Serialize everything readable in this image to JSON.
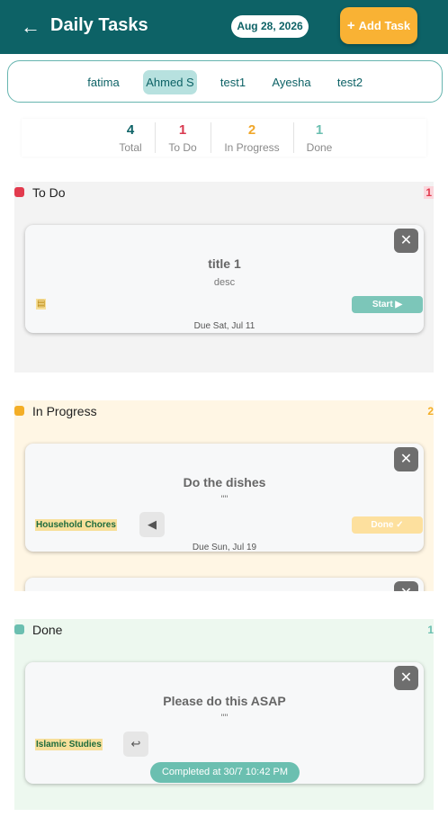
{
  "header": {
    "title": "Daily Tasks",
    "back_icon": "arrow-left-icon",
    "back_glyph": "←",
    "date": "Aug 28, 2026",
    "add_task_icon": "plus-icon",
    "add_task_glyph": "+",
    "add_task_label": "Add Task"
  },
  "users": {
    "items": [
      "fatima",
      "Ahmed S",
      "test1",
      "Ayesha",
      "test2"
    ],
    "selected": "Ahmed S"
  },
  "stats": [
    {
      "value": "4",
      "label": "Total",
      "color": "#0d6266"
    },
    {
      "value": "1",
      "label": "To Do",
      "color": "#d9394f"
    },
    {
      "value": "2",
      "label": "In Progress",
      "color": "#f0a72a"
    },
    {
      "value": "1",
      "label": "Done",
      "color": "#6bbfb0"
    }
  ],
  "sections": {
    "todo": {
      "title": "To Do",
      "count": "1",
      "color": "#e23b4e",
      "bg": "#f3f3f3",
      "cards": [
        {
          "title": "title 1",
          "desc": "desc",
          "tag_icon": "note-icon",
          "tag_glyph": "▤",
          "action_label": "Start ▶",
          "due": "Due Sat, Jul 11",
          "close_glyph": "✕"
        }
      ]
    },
    "in_progress": {
      "title": "In Progress",
      "count": "2",
      "color": "#f4ae26",
      "bg": "#fff6e4",
      "cards": [
        {
          "title": "Do the dishes",
          "desc": "\"\"",
          "tag": "Household Chores",
          "back_glyph": "◀",
          "action_label": "Done ✓",
          "due": "Due Sun, Jul 19",
          "close_glyph": "✕"
        }
      ]
    },
    "done": {
      "title": "Done",
      "count": "1",
      "color": "#6bbfb0",
      "bg": "#edf8ef",
      "cards": [
        {
          "title": "Please do this ASAP",
          "desc": "\"\"",
          "tag": "Islamic Studies",
          "undo_glyph": "↩",
          "completed": "Completed at  30/7 10:42 PM",
          "close_glyph": "✕"
        }
      ]
    }
  },
  "colors": {
    "header": "#0d6266",
    "accent": "#f9b234",
    "start": "#7cc6b9",
    "done_btn": "#fde09e"
  }
}
